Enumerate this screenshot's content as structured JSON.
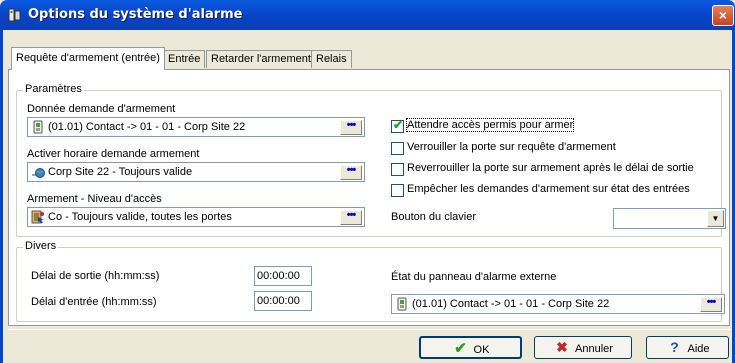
{
  "window": {
    "title": "Options du système d'alarme",
    "close_glyph": "×"
  },
  "tabs": [
    {
      "label": "Requête d'armement (entrée)",
      "active": true
    },
    {
      "label": "Entrée",
      "active": false
    },
    {
      "label": "Retarder l'armement",
      "active": false
    },
    {
      "label": "Relais",
      "active": false
    }
  ],
  "parametres": {
    "legend": "Paramètres",
    "donnee_label": "Donnée demande d'armement",
    "donnee_value": "(01.01) Contact -> 01 - 01 - Corp Site 22",
    "horaire_label": "Activer horaire demande armement",
    "horaire_value": "Corp Site 22 - Toujours valide",
    "niveau_label": "Armement - Niveau d'accès",
    "niveau_value": "Co - Toujours valide, toutes les portes",
    "browse_glyph": "•••",
    "checkboxes": [
      {
        "label": "Attendre accès permis pour armer",
        "checked": true
      },
      {
        "label": "Verrouiller la porte sur requête d'armement",
        "checked": false
      },
      {
        "label": "Reverrouiller la porte sur armement après le délai de sortie",
        "checked": false
      },
      {
        "label": "Empêcher les demandes d'armement sur état des entrées",
        "checked": false
      }
    ],
    "check_glyph": "✔",
    "bouton_label": "Bouton du clavier",
    "bouton_value": "",
    "dropdown_glyph": "▼"
  },
  "divers": {
    "legend": "Divers",
    "sortie_label": "Délai de sortie (hh:mm:ss)",
    "sortie_value": "00:00:00",
    "entree_label": "Délai d'entrée (hh:mm:ss)",
    "entree_value": "00:00:00",
    "panneau_label": "État du panneau d'alarme externe",
    "panneau_value": "(01.01) Contact -> 01 - 01 - Corp Site 22"
  },
  "buttons": {
    "ok": "OK",
    "ok_glyph": "✔",
    "cancel": "Annuler",
    "cancel_glyph": "✖",
    "help": "Aide",
    "help_glyph": "?"
  },
  "colors": {
    "title_bar": "#0844C8",
    "dialog_bg": "#ECE9D8",
    "ok_icon": "#21A121",
    "cancel_icon": "#C0282D",
    "help_icon": "#1F4FB5",
    "browse_dots": "#0000C0"
  }
}
